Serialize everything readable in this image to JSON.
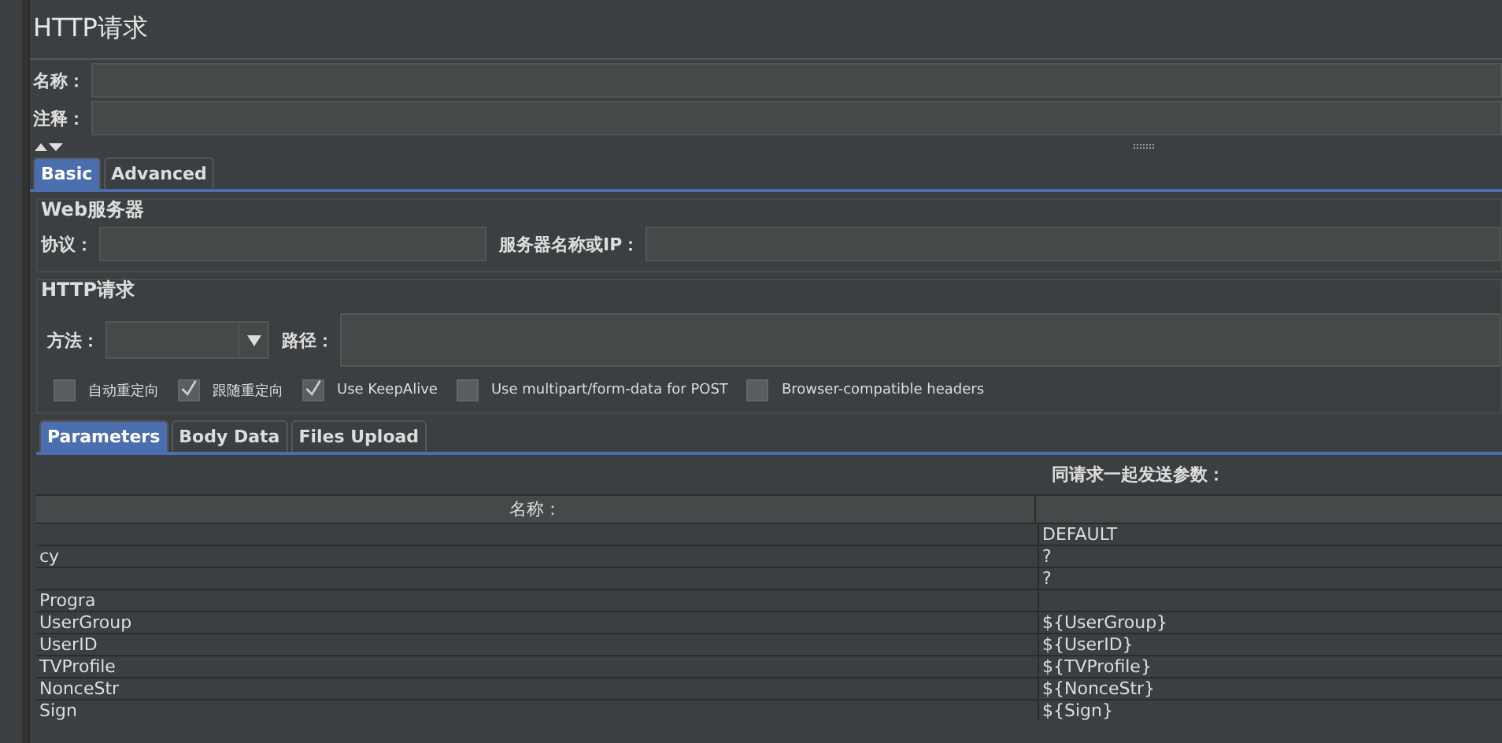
{
  "title": "HTTP请求",
  "name_label": "名称：",
  "comment_label": "注释：",
  "tabs": [
    {
      "label": "Basic",
      "selected": true
    },
    {
      "label": "Advanced",
      "selected": false
    }
  ],
  "web_server": {
    "legend": "Web服务器",
    "protocol_label": "协议：",
    "server_label": "服务器名称或IP："
  },
  "http_request": {
    "legend": "HTTP请求",
    "method_label": "方法：",
    "path_label": "路径："
  },
  "options": [
    {
      "label": "自动重定向",
      "checked": false
    },
    {
      "label": "跟随重定向",
      "checked": true
    },
    {
      "label": "Use KeepAlive",
      "checked": true
    },
    {
      "label": "Use multipart/form-data for POST",
      "checked": false
    },
    {
      "label": "Browser-compatible headers",
      "checked": false
    }
  ],
  "param_tabs": [
    {
      "label": "Parameters",
      "selected": true
    },
    {
      "label": "Body Data",
      "selected": false
    },
    {
      "label": "Files Upload",
      "selected": false
    }
  ],
  "table": {
    "caption": "同请求一起发送参数：",
    "columns": [
      "名称："
    ],
    "rows": [
      {
        "value": "DEFAULT"
      },
      {
        "name": "cy",
        "value": "?"
      },
      {
        "value": "?"
      },
      {
        "name": "Progra"
      },
      {
        "name": "UserGroup",
        "value": "${UserGroup}"
      },
      {
        "name": "UserID",
        "value": "${UserID}"
      },
      {
        "name": "TVProfile",
        "value": "${TVProfile}"
      },
      {
        "name": "NonceStr",
        "value": "${NonceStr}"
      },
      {
        "name": "Sign",
        "value": "${Sign}"
      }
    ]
  }
}
